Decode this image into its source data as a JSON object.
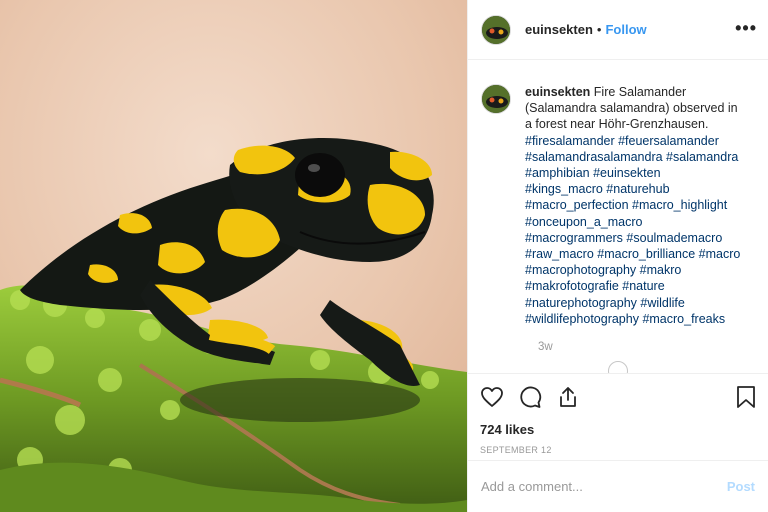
{
  "post": {
    "image_alt": "Fire salamander on moss"
  },
  "header": {
    "username": "euinsekten",
    "separator": "•",
    "follow_label": "Follow",
    "more_label": "•••"
  },
  "caption": {
    "username": "euinsekten",
    "text": " Fire Salamander (Salamandra salamandra) observed in a forest near Höhr-Grenzhausen.",
    "hashtags": "#firesalamander #feuersalamander #salamandrasalamandra #salamandra #amphibian #euinsekten #kings_macro #naturehub #macro_perfection #macro_highlight #onceupon_a_macro #macrogrammers #soulmademacro #raw_macro #macro_brilliance #macro #macrophotography #makro #makrofotografie #nature #naturephotography #wildlife #wildlifephotography #macro_freaks",
    "age": "3w"
  },
  "actions": {
    "icons": [
      "heart-icon",
      "comment-icon",
      "share-icon",
      "bookmark-icon"
    ],
    "likes": "724 likes",
    "date": "SEPTEMBER 12"
  },
  "comment_box": {
    "placeholder": "Add a comment...",
    "post_label": "Post"
  },
  "colors": {
    "link": "#3897f0",
    "hashtag": "#003569",
    "post_disabled": "#b3dbff"
  }
}
